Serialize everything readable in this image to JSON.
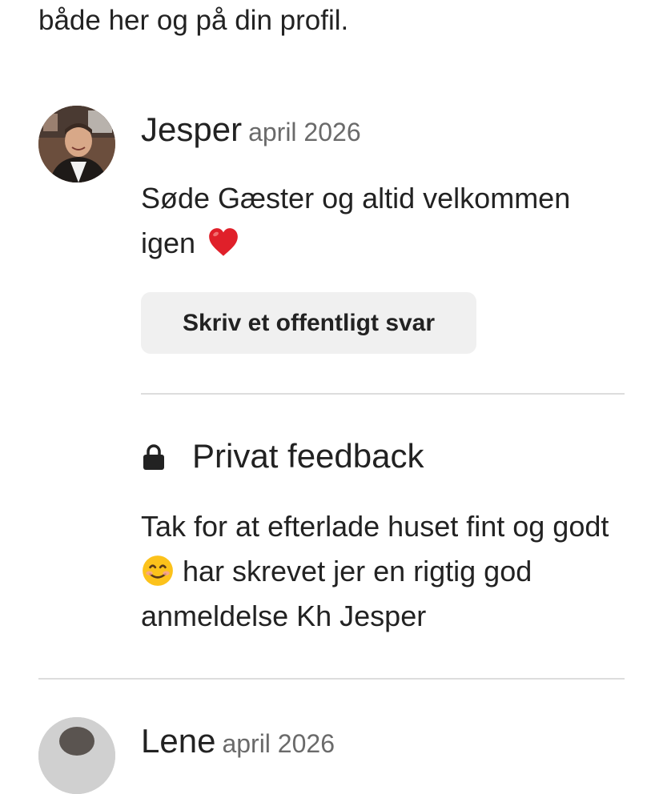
{
  "intro": {
    "text": "både her og på din profil."
  },
  "review": {
    "reviewer_name": "Jesper",
    "date": "april 2026",
    "text": "Søde Gæster og altid velkommen igen",
    "emoji_icon": "red-heart-icon",
    "reply_button_label": "Skriv et offentligt svar"
  },
  "private_feedback": {
    "icon": "lock-icon",
    "title": "Privat feedback",
    "text_before_emoji": "Tak for at efterlade huset fint og godt",
    "emoji_icon": "smiling-face-icon",
    "text_after_emoji": "har skrevet jer en rigtig god anmeldelse Kh Jesper"
  },
  "next_review": {
    "reviewer_name": "Lene",
    "date": "april 2026"
  },
  "colors": {
    "text": "#222222",
    "muted": "#6a6a6a",
    "button_bg": "#f0f0f0",
    "divider": "#dddddd",
    "heart": "#e0202a"
  }
}
